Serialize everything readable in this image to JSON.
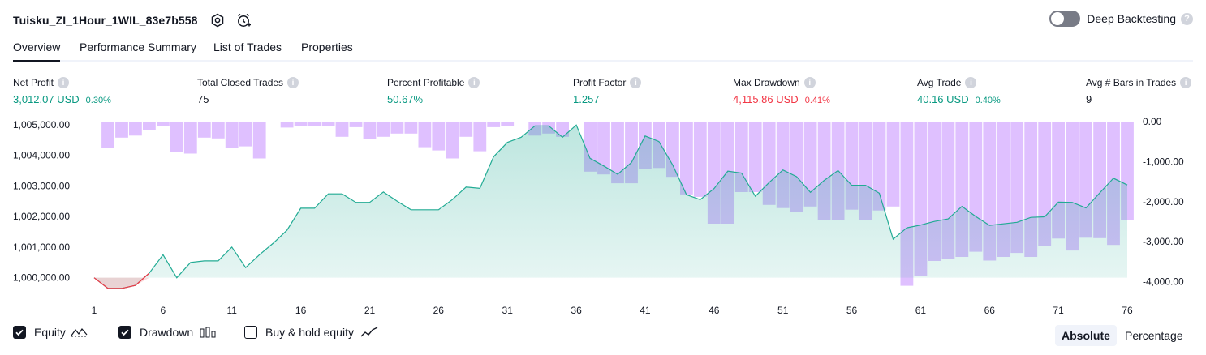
{
  "header": {
    "title": "Tuisku_ZI_1Hour_1WIL_83e7b558",
    "deep_backtesting_label": "Deep Backtesting",
    "deep_backtesting_enabled": false,
    "help_glyph": "?"
  },
  "tabs": [
    {
      "label": "Overview",
      "active": true
    },
    {
      "label": "Performance Summary",
      "active": false
    },
    {
      "label": "List of Trades",
      "active": false
    },
    {
      "label": "Properties",
      "active": false
    }
  ],
  "metrics": [
    {
      "label": "Net Profit",
      "value": "3,012.07 USD",
      "pct": "0.30%",
      "color": "green"
    },
    {
      "label": "Total Closed Trades",
      "value": "75",
      "pct": "",
      "color": "black"
    },
    {
      "label": "Percent Profitable",
      "value": "50.67%",
      "pct": "",
      "color": "green"
    },
    {
      "label": "Profit Factor",
      "value": "1.257",
      "pct": "",
      "color": "green"
    },
    {
      "label": "Max Drawdown",
      "value": "4,115.86 USD",
      "pct": "0.41%",
      "color": "red"
    },
    {
      "label": "Avg Trade",
      "value": "40.16 USD",
      "pct": "0.40%",
      "color": "green"
    },
    {
      "label": "Avg # Bars in Trades",
      "value": "9",
      "pct": "",
      "color": "black"
    }
  ],
  "colors": {
    "green": "#089981",
    "red": "#f23645",
    "drawdown": "#d9b5ff",
    "equity_line": "#22ab94"
  },
  "chart_data": {
    "type": "area",
    "x": [
      1,
      2,
      3,
      4,
      5,
      6,
      7,
      8,
      9,
      10,
      11,
      12,
      13,
      14,
      15,
      16,
      17,
      18,
      19,
      20,
      21,
      22,
      23,
      24,
      25,
      26,
      27,
      28,
      29,
      30,
      31,
      32,
      33,
      34,
      35,
      36,
      37,
      38,
      39,
      40,
      41,
      42,
      43,
      44,
      45,
      46,
      47,
      48,
      49,
      50,
      51,
      52,
      53,
      54,
      55,
      56,
      57,
      58,
      59,
      60,
      61,
      62,
      63,
      64,
      65,
      66,
      67,
      68,
      69,
      70,
      71,
      72,
      73,
      74,
      75,
      76
    ],
    "x_ticks": [
      "1",
      "6",
      "11",
      "16",
      "21",
      "26",
      "31",
      "36",
      "41",
      "46",
      "51",
      "56",
      "61",
      "66",
      "71",
      "76"
    ],
    "equity_axis": {
      "ticks": [
        "1,000,000.00",
        "1,001,000.00",
        "1,002,000.00",
        "1,003,000.00",
        "1,004,000.00",
        "1,005,000.00"
      ],
      "range": [
        999700,
        1005100
      ]
    },
    "drawdown_axis": {
      "ticks": [
        "0.00",
        "-1,000.00",
        "-2,000.00",
        "-3,000.00",
        "-4,000.00"
      ],
      "range": [
        -4250,
        0
      ]
    },
    "series": [
      {
        "name": "Equity",
        "values": [
          1000000,
          999650,
          999650,
          999750,
          1000150,
          1000750,
          1000000,
          1000500,
          1000550,
          1000550,
          1001000,
          1000330,
          1000750,
          1001130,
          1001550,
          1002270,
          1002270,
          1002740,
          1002740,
          1002460,
          1002460,
          1002800,
          1002500,
          1002220,
          1002220,
          1002220,
          1002550,
          1002960,
          1002920,
          1003950,
          1004420,
          1004590,
          1004960,
          1004960,
          1004590,
          1004990,
          1003900,
          1003650,
          1003380,
          1003760,
          1004630,
          1004450,
          1003680,
          1002710,
          1002550,
          1002910,
          1003480,
          1003420,
          1002660,
          1003110,
          1003520,
          1003300,
          1002790,
          1003180,
          1003500,
          1003020,
          1003020,
          1002760,
          1001260,
          1001630,
          1001720,
          1001840,
          1001920,
          1002330,
          1002000,
          1001710,
          1001760,
          1001810,
          1001970,
          1001990,
          1002470,
          1002460,
          1002280,
          1002770,
          1003250,
          1003030
        ]
      },
      {
        "name": "Drawdown",
        "values": [
          0,
          -650,
          -400,
          -350,
          -220,
          -120,
          -750,
          -800,
          -400,
          -420,
          -650,
          -620,
          -920,
          0,
          -150,
          -120,
          -110,
          -120,
          -380,
          -140,
          -440,
          -380,
          -300,
          -300,
          -640,
          -720,
          -920,
          -380,
          -740,
          -140,
          -120,
          0,
          -350,
          -300,
          -380,
          0,
          -1250,
          -1320,
          -1540,
          -1540,
          -1180,
          -1160,
          -1380,
          -1820,
          -1880,
          -2550,
          -2550,
          -1760,
          -1760,
          -2080,
          -2160,
          -2250,
          -2120,
          -2460,
          -2470,
          -2200,
          -2460,
          -2220,
          -2120,
          -4100,
          -3850,
          -3480,
          -3440,
          -3380,
          -3250,
          -3470,
          -3380,
          -3280,
          -3380,
          -3100,
          -2920,
          -3220,
          -2900,
          -2910,
          -3080,
          -2460
        ]
      }
    ]
  },
  "legend": {
    "equity_label": "Equity",
    "equity_checked": true,
    "drawdown_label": "Drawdown",
    "drawdown_checked": true,
    "buyhold_label": "Buy & hold equity",
    "buyhold_checked": false
  },
  "view_toggle": {
    "absolute_label": "Absolute",
    "percentage_label": "Percentage",
    "selected": "Absolute"
  }
}
